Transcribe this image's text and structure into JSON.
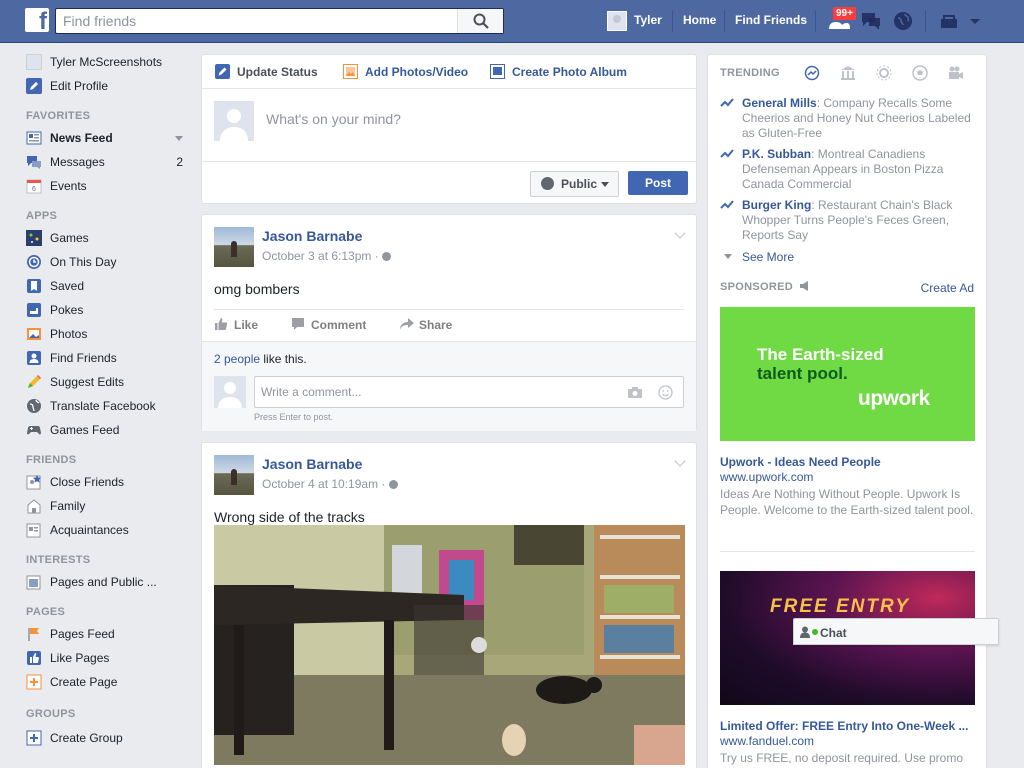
{
  "topbar": {
    "logo": "f",
    "search_placeholder": "Find friends",
    "user_name": "Tyler",
    "home": "Home",
    "find_friends": "Find Friends",
    "friend_requests_badge": "99+"
  },
  "leftnav": {
    "profile_name": "Tyler McScreenshots",
    "edit_profile": "Edit Profile",
    "sections": {
      "favorites": "FAVORITES",
      "apps": "APPS",
      "friends": "FRIENDS",
      "interests": "INTERESTS",
      "pages": "PAGES",
      "groups": "GROUPS"
    },
    "favorites": [
      {
        "label": "News Feed",
        "icon": "news-feed-icon"
      },
      {
        "label": "Messages",
        "icon": "messages-icon",
        "count": "2"
      },
      {
        "label": "Events",
        "icon": "events-icon"
      }
    ],
    "apps": [
      {
        "label": "Games",
        "icon": "games-icon"
      },
      {
        "label": "On This Day",
        "icon": "on-this-day-icon"
      },
      {
        "label": "Saved",
        "icon": "saved-icon"
      },
      {
        "label": "Pokes",
        "icon": "pokes-icon"
      },
      {
        "label": "Photos",
        "icon": "photos-icon"
      },
      {
        "label": "Find Friends",
        "icon": "find-friends-icon"
      },
      {
        "label": "Suggest Edits",
        "icon": "suggest-edits-icon"
      },
      {
        "label": "Translate Facebook",
        "icon": "translate-icon"
      },
      {
        "label": "Games Feed",
        "icon": "games-feed-icon"
      }
    ],
    "friends": [
      {
        "label": "Close Friends",
        "icon": "close-friends-icon"
      },
      {
        "label": "Family",
        "icon": "family-icon"
      },
      {
        "label": "Acquaintances",
        "icon": "acquaintances-icon"
      }
    ],
    "interests": [
      {
        "label": "Pages and Public ...",
        "icon": "pages-public-icon"
      }
    ],
    "pages": [
      {
        "label": "Pages Feed",
        "icon": "pages-feed-icon"
      },
      {
        "label": "Like Pages",
        "icon": "like-pages-icon"
      },
      {
        "label": "Create Page",
        "icon": "create-page-icon"
      }
    ],
    "groups": [
      {
        "label": "Create Group",
        "icon": "create-group-icon"
      }
    ]
  },
  "composer": {
    "tab_status": "Update Status",
    "tab_photos": "Add Photos/Video",
    "tab_album": "Create Photo Album",
    "placeholder": "What's on your mind?",
    "privacy": "Public",
    "post_button": "Post"
  },
  "posts": [
    {
      "author": "Jason Barnabe",
      "time": "October 3 at 6:13pm",
      "text": "omg bombers",
      "like": "Like",
      "comment": "Comment",
      "share": "Share",
      "likes_link": "2 people",
      "likes_rest": " like this.",
      "comment_placeholder": "Write a comment...",
      "comment_hint": "Press Enter to post."
    },
    {
      "author": "Jason Barnabe",
      "time": "October 4 at 10:19am",
      "text": "Wrong side of the tracks"
    }
  ],
  "trending": {
    "heading": "TRENDING",
    "items": [
      {
        "name": "General Mills",
        "desc": ": Company Recalls Some Cheerios and Honey Nut Cheerios Labeled as Gluten-Free"
      },
      {
        "name": "P.K. Subban",
        "desc": ": Montreal Canadiens Defenseman Appears in Boston Pizza Canada Commercial"
      },
      {
        "name": "Burger King",
        "desc": ": Restaurant Chain's Black Whopper Turns People's Feces Green, Reports Say"
      }
    ],
    "see_more": "See More"
  },
  "sponsored": {
    "heading": "SPONSORED",
    "create_ad": "Create Ad",
    "ads": [
      {
        "img_line1": "The Earth-sized",
        "img_line2": "talent pool.",
        "img_logo": "upwork",
        "title": "Upwork - Ideas Need People",
        "url": "www.upwork.com",
        "desc": "Ideas Are Nothing Without People. Upwork Is People. Welcome to the Earth-sized talent pool."
      },
      {
        "img_text": "FREE ENTRY",
        "title": "Limited Offer: FREE Entry Into One-Week ...",
        "url": "www.fanduel.com",
        "desc": "Try us FREE, no deposit required. Use promo"
      }
    ]
  },
  "chat": {
    "label": "Chat"
  },
  "colors": {
    "brand": "#4e69a2",
    "link": "#365899",
    "badge": "#fa3e3e",
    "upwork": "#6fda44"
  }
}
